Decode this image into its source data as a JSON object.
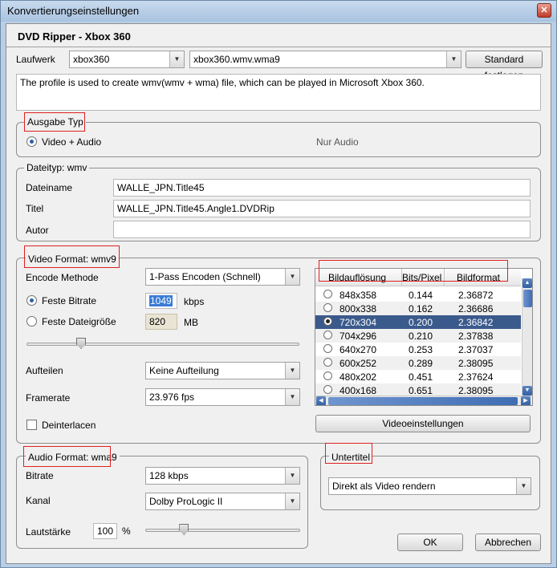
{
  "window": {
    "title": "Konvertierungseinstellungen",
    "close_glyph": "✕"
  },
  "profile_name": "DVD Ripper - Xbox 360",
  "laufwerk": {
    "label": "Laufwerk",
    "device": "xbox360",
    "profile": "xbox360.wmv.wma9",
    "default_button": "Standard festlegen"
  },
  "description": "The profile is used to create wmv(wmv + wma) file, which can be played in Microsoft Xbox 360.",
  "ausgabe_typ": {
    "legend": "Ausgabe Typ",
    "option_video_audio": "Video + Audio",
    "option_audio_only": "Nur Audio",
    "selected": "Video + Audio"
  },
  "dateityp": {
    "legend": "Dateityp: wmv",
    "dateiname_label": "Dateiname",
    "dateiname_value": "WALLE_JPN.Title45",
    "titel_label": "Titel",
    "titel_value": "WALLE_JPN.Title45.Angle1.DVDRip",
    "autor_label": "Autor",
    "autor_value": ""
  },
  "video_format": {
    "legend": "Video Format: wmv9",
    "encode_label": "Encode Methode",
    "encode_value": "1-Pass Encoden (Schnell)",
    "feste_bitrate_label": "Feste Bitrate",
    "bitrate_value": "1049",
    "bitrate_unit": "kbps",
    "feste_dateigroesse_label": "Feste Dateigröße",
    "dateigroesse_value": "820",
    "dateigroesse_unit": "MB",
    "quality_slider_fraction": 0.2,
    "aufteilen_label": "Aufteilen",
    "aufteilen_value": "Keine Aufteilung",
    "framerate_label": "Framerate",
    "framerate_value": "23.976 fps",
    "deinterlacen_label": "Deinterlacen",
    "deinterlacen_checked": false,
    "resolution_table": {
      "headers": [
        "Bildauflösung",
        "Bits/Pixel",
        "Bildformat"
      ],
      "rows": [
        {
          "resolution": "848x358",
          "bits": "0.144",
          "format": "2.36872"
        },
        {
          "resolution": "800x338",
          "bits": "0.162",
          "format": "2.36686"
        },
        {
          "resolution": "720x304",
          "bits": "0.200",
          "format": "2.36842"
        },
        {
          "resolution": "704x296",
          "bits": "0.210",
          "format": "2.37838"
        },
        {
          "resolution": "640x270",
          "bits": "0.253",
          "format": "2.37037"
        },
        {
          "resolution": "600x252",
          "bits": "0.289",
          "format": "2.38095"
        },
        {
          "resolution": "480x202",
          "bits": "0.451",
          "format": "2.37624"
        },
        {
          "resolution": "400x168",
          "bits": "0.651",
          "format": "2.38095"
        }
      ],
      "selected_index": 2
    },
    "video_settings_button": "Videoeinstellungen"
  },
  "audio_format": {
    "legend": "Audio Format: wma9",
    "bitrate_label": "Bitrate",
    "bitrate_value": "128 kbps",
    "kanal_label": "Kanal",
    "kanal_value": "Dolby ProLogic II",
    "lautstaerke_label": "Lautstärke",
    "lautstaerke_value": "100",
    "lautstaerke_unit": "%",
    "volume_slider_fraction": 0.25
  },
  "untertitel": {
    "legend": "Untertitel",
    "value": "Direkt als Video rendern"
  },
  "buttons": {
    "ok": "OK",
    "cancel": "Abbrechen"
  },
  "icons": {
    "combo_arrow": "▼",
    "scroll_up": "▲",
    "scroll_down": "▼",
    "scroll_left": "◀",
    "scroll_right": "▶"
  },
  "colors": {
    "selection": "#3b5a8c",
    "annotation_red": "#e02020",
    "title_bar": "#b9cfe6"
  }
}
